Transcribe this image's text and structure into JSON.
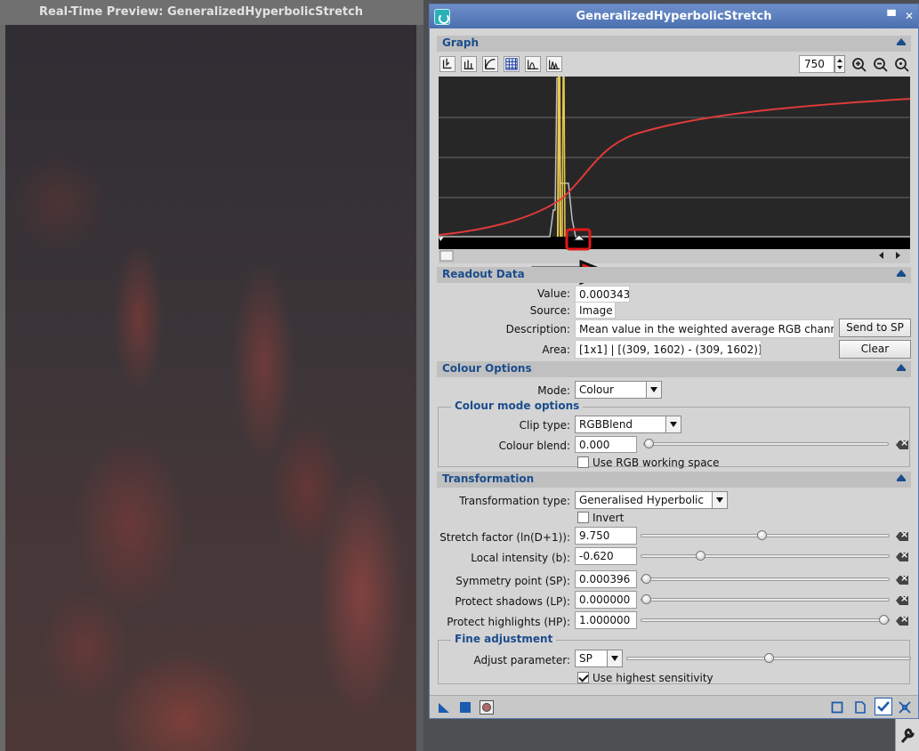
{
  "preview": {
    "title": "Real-Time Preview: GeneralizedHyperbolicStretch"
  },
  "window": {
    "title": "GeneralizedHyperbolicStretch"
  },
  "graph": {
    "section_title": "Graph",
    "zoom_value": "750"
  },
  "readout": {
    "section_title": "Readout Data",
    "value_label": "Value:",
    "value": "0.000343",
    "source_label": "Source:",
    "source": "Image",
    "description_label": "Description:",
    "description": "Mean value in the weighted average RGB channel",
    "send_to_sp_label": "Send to SP",
    "area_label": "Area:",
    "area": "[1x1] | [(309, 1602) - (309, 1602)]",
    "clear_label": "Clear"
  },
  "colour_options": {
    "section_title": "Colour Options",
    "mode_label": "Mode:",
    "mode_value": "Colour",
    "colour_mode_group": "Colour mode options",
    "clip_type_label": "Clip type:",
    "clip_type_value": "RGBBlend",
    "colour_blend_label": "Colour blend:",
    "colour_blend_value": "0.000",
    "colour_blend_level": 0.0,
    "use_rgb_label": "Use RGB working space",
    "use_rgb_checked": false
  },
  "transformation": {
    "section_title": "Transformation",
    "type_label": "Transformation type:",
    "type_value": "Generalised Hyperbolic",
    "invert_label": "Invert",
    "invert_checked": false,
    "stretch_label": "Stretch factor (ln(D+1)):",
    "stretch_value": "9.750",
    "stretch_level": 0.486,
    "local_label": "Local intensity (b):",
    "local_value": "-0.620",
    "local_level": 0.23,
    "sp_label": "Symmetry point (SP):",
    "sp_value": "0.000396",
    "sp_level": 0.0,
    "lp_label": "Protect shadows (LP):",
    "lp_value": "0.000000",
    "lp_level": 0.0,
    "hp_label": "Protect highlights (HP):",
    "hp_value": "1.000000",
    "hp_level": 1.0
  },
  "fine_adjustment": {
    "group_title": "Fine adjustment",
    "adjust_label": "Adjust parameter:",
    "adjust_value": "SP",
    "adjust_level": 0.5,
    "sensitivity_label": "Use highest sensitivity",
    "sensitivity_checked": true
  },
  "colors": {
    "section_title": "#1b4d8c",
    "curve": "#e03a3a",
    "histogram_peak": "#e8c84a",
    "annotation": "#e01818"
  }
}
